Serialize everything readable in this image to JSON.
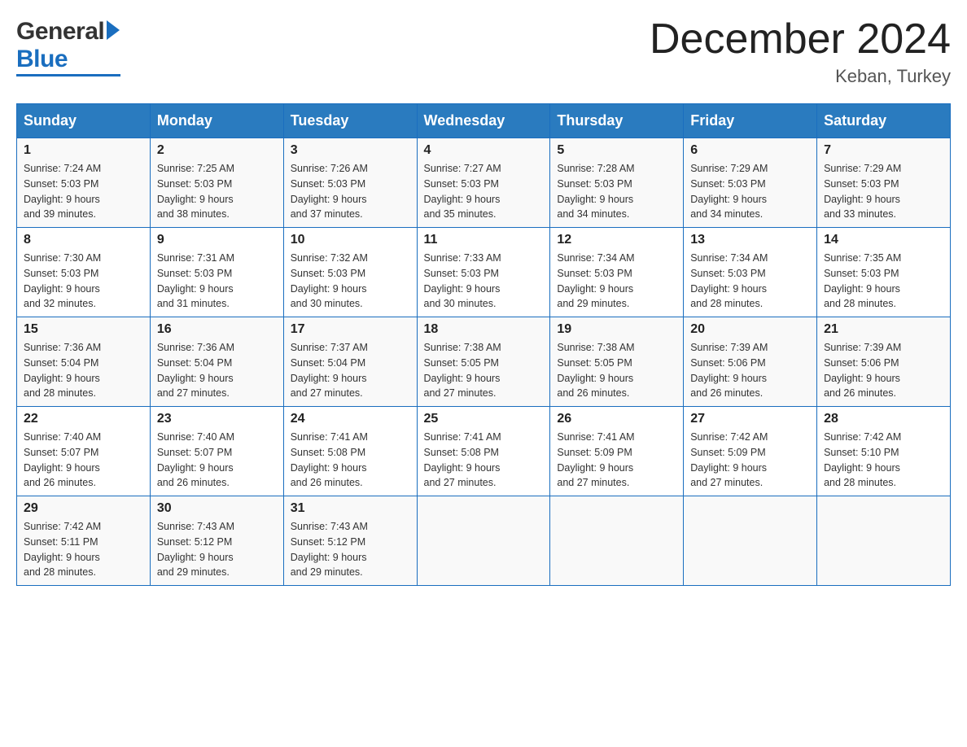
{
  "header": {
    "logo_general": "General",
    "logo_blue": "Blue",
    "title": "December 2024",
    "location": "Keban, Turkey"
  },
  "weekdays": [
    "Sunday",
    "Monday",
    "Tuesday",
    "Wednesday",
    "Thursday",
    "Friday",
    "Saturday"
  ],
  "weeks": [
    [
      {
        "day": "1",
        "sunrise": "7:24 AM",
        "sunset": "5:03 PM",
        "daylight": "9 hours and 39 minutes."
      },
      {
        "day": "2",
        "sunrise": "7:25 AM",
        "sunset": "5:03 PM",
        "daylight": "9 hours and 38 minutes."
      },
      {
        "day": "3",
        "sunrise": "7:26 AM",
        "sunset": "5:03 PM",
        "daylight": "9 hours and 37 minutes."
      },
      {
        "day": "4",
        "sunrise": "7:27 AM",
        "sunset": "5:03 PM",
        "daylight": "9 hours and 35 minutes."
      },
      {
        "day": "5",
        "sunrise": "7:28 AM",
        "sunset": "5:03 PM",
        "daylight": "9 hours and 34 minutes."
      },
      {
        "day": "6",
        "sunrise": "7:29 AM",
        "sunset": "5:03 PM",
        "daylight": "9 hours and 34 minutes."
      },
      {
        "day": "7",
        "sunrise": "7:29 AM",
        "sunset": "5:03 PM",
        "daylight": "9 hours and 33 minutes."
      }
    ],
    [
      {
        "day": "8",
        "sunrise": "7:30 AM",
        "sunset": "5:03 PM",
        "daylight": "9 hours and 32 minutes."
      },
      {
        "day": "9",
        "sunrise": "7:31 AM",
        "sunset": "5:03 PM",
        "daylight": "9 hours and 31 minutes."
      },
      {
        "day": "10",
        "sunrise": "7:32 AM",
        "sunset": "5:03 PM",
        "daylight": "9 hours and 30 minutes."
      },
      {
        "day": "11",
        "sunrise": "7:33 AM",
        "sunset": "5:03 PM",
        "daylight": "9 hours and 30 minutes."
      },
      {
        "day": "12",
        "sunrise": "7:34 AM",
        "sunset": "5:03 PM",
        "daylight": "9 hours and 29 minutes."
      },
      {
        "day": "13",
        "sunrise": "7:34 AM",
        "sunset": "5:03 PM",
        "daylight": "9 hours and 28 minutes."
      },
      {
        "day": "14",
        "sunrise": "7:35 AM",
        "sunset": "5:03 PM",
        "daylight": "9 hours and 28 minutes."
      }
    ],
    [
      {
        "day": "15",
        "sunrise": "7:36 AM",
        "sunset": "5:04 PM",
        "daylight": "9 hours and 28 minutes."
      },
      {
        "day": "16",
        "sunrise": "7:36 AM",
        "sunset": "5:04 PM",
        "daylight": "9 hours and 27 minutes."
      },
      {
        "day": "17",
        "sunrise": "7:37 AM",
        "sunset": "5:04 PM",
        "daylight": "9 hours and 27 minutes."
      },
      {
        "day": "18",
        "sunrise": "7:38 AM",
        "sunset": "5:05 PM",
        "daylight": "9 hours and 27 minutes."
      },
      {
        "day": "19",
        "sunrise": "7:38 AM",
        "sunset": "5:05 PM",
        "daylight": "9 hours and 26 minutes."
      },
      {
        "day": "20",
        "sunrise": "7:39 AM",
        "sunset": "5:06 PM",
        "daylight": "9 hours and 26 minutes."
      },
      {
        "day": "21",
        "sunrise": "7:39 AM",
        "sunset": "5:06 PM",
        "daylight": "9 hours and 26 minutes."
      }
    ],
    [
      {
        "day": "22",
        "sunrise": "7:40 AM",
        "sunset": "5:07 PM",
        "daylight": "9 hours and 26 minutes."
      },
      {
        "day": "23",
        "sunrise": "7:40 AM",
        "sunset": "5:07 PM",
        "daylight": "9 hours and 26 minutes."
      },
      {
        "day": "24",
        "sunrise": "7:41 AM",
        "sunset": "5:08 PM",
        "daylight": "9 hours and 26 minutes."
      },
      {
        "day": "25",
        "sunrise": "7:41 AM",
        "sunset": "5:08 PM",
        "daylight": "9 hours and 27 minutes."
      },
      {
        "day": "26",
        "sunrise": "7:41 AM",
        "sunset": "5:09 PM",
        "daylight": "9 hours and 27 minutes."
      },
      {
        "day": "27",
        "sunrise": "7:42 AM",
        "sunset": "5:09 PM",
        "daylight": "9 hours and 27 minutes."
      },
      {
        "day": "28",
        "sunrise": "7:42 AM",
        "sunset": "5:10 PM",
        "daylight": "9 hours and 28 minutes."
      }
    ],
    [
      {
        "day": "29",
        "sunrise": "7:42 AM",
        "sunset": "5:11 PM",
        "daylight": "9 hours and 28 minutes."
      },
      {
        "day": "30",
        "sunrise": "7:43 AM",
        "sunset": "5:12 PM",
        "daylight": "9 hours and 29 minutes."
      },
      {
        "day": "31",
        "sunrise": "7:43 AM",
        "sunset": "5:12 PM",
        "daylight": "9 hours and 29 minutes."
      },
      null,
      null,
      null,
      null
    ]
  ],
  "labels": {
    "sunrise": "Sunrise: ",
    "sunset": "Sunset: ",
    "daylight": "Daylight: "
  }
}
